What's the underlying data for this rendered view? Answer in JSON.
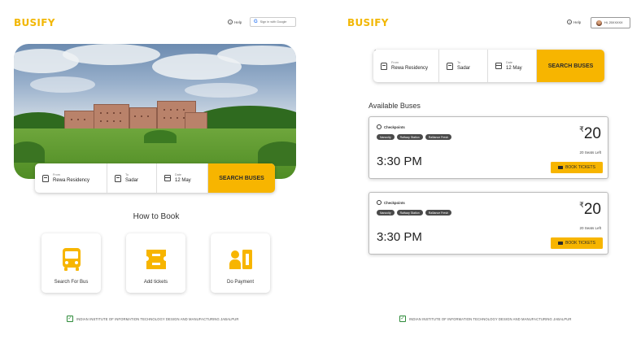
{
  "brand": {
    "name": "BUSIFY",
    "color": "#f2b705"
  },
  "accent": "#f7b500",
  "left_screen": {
    "help_label": "Help",
    "signin_label": "Sign in with Google",
    "search": {
      "from_label": "From",
      "from_value": "Rewa Residency",
      "to_label": "To",
      "to_value": "Sadar",
      "date_label": "Date",
      "date_value": "12 May",
      "button_label": "SEARCH BUSES"
    },
    "how_to_book": {
      "title": "How to Book",
      "steps": [
        {
          "label": "Search For Bus",
          "icon": "bus-icon"
        },
        {
          "label": "Add tickets",
          "icon": "ticket-icon"
        },
        {
          "label": "Do Payment",
          "icon": "payment-icon"
        }
      ]
    },
    "footer": "INDIAN INSTITUTE OF INFORMATION TECHNOLOGY DESIGN AND MANUFACTURING JABALPUR"
  },
  "right_screen": {
    "help_label": "Help",
    "user_label": "Hi, 20XXXXX",
    "search": {
      "from_label": "From",
      "from_value": "Rewa Residency",
      "to_label": "To",
      "to_value": "Sadar",
      "date_label": "Date",
      "date_value": "12 May",
      "button_label": "SEARCH BUSES"
    },
    "available_title": "Available Buses",
    "buses": [
      {
        "checkpoints_label": "Checkpoints",
        "checkpoints": [
          "Nanocity",
          "Railway Station",
          "Ralliance Fresh"
        ],
        "time": "3:30 PM",
        "currency": "₹",
        "price": "20",
        "seats": "20 Seats Left",
        "book_label": "BOOK TICKETS"
      },
      {
        "checkpoints_label": "Checkpoints",
        "checkpoints": [
          "Nanocity",
          "Railway Station",
          "Ralliance Fresh"
        ],
        "time": "3:30 PM",
        "currency": "₹",
        "price": "20",
        "seats": "20 Seats Left",
        "book_label": "BOOK TICKETS"
      }
    ],
    "footer": "INDIAN INSTITUTE OF INFORMATION TECHNOLOGY DESIGN AND MANUFACTURING JABALPUR"
  }
}
